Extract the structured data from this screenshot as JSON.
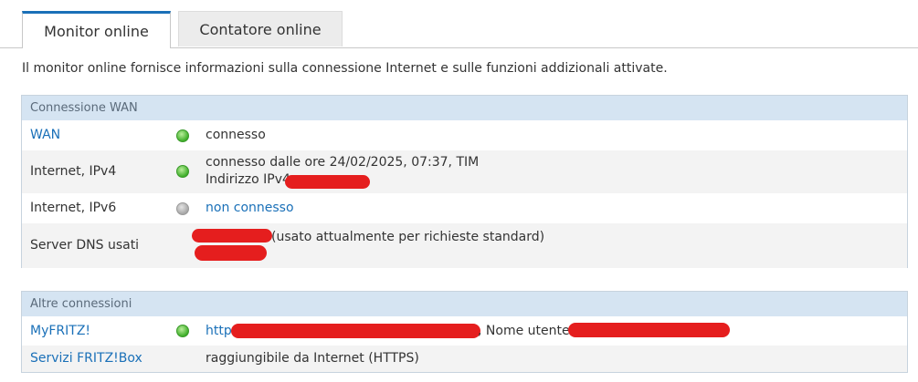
{
  "tabs": {
    "monitor_label": "Monitor online",
    "counter_label": "Contatore online"
  },
  "intro_text": "Il monitor online fornisce informazioni sulla connessione Internet e sulle funzioni addizionali attivate.",
  "wan_panel": {
    "title": "Connessione WAN",
    "rows": [
      {
        "label": "WAN",
        "status": "green",
        "value": "connesso"
      },
      {
        "label": "Internet, IPv4",
        "status": "green",
        "value": "connesso dalle ore 24/02/2025, 07:37, TIM",
        "value2": "Indirizzo IPv4"
      },
      {
        "label": "Internet, IPv6",
        "status": "grey",
        "value": "non connesso"
      },
      {
        "label": "Server DNS usati",
        "value": "(usato attualmente per richieste standard)"
      }
    ]
  },
  "other_panel": {
    "title": "Altre connessioni",
    "rows": [
      {
        "label": "MyFRITZ!",
        "status": "green",
        "value_prefix": "http",
        "value_middle": ", Nome utente:"
      },
      {
        "label": "Servizi FRITZ!Box",
        "value": "raggiungibile da Internet (HTTPS)"
      }
    ]
  },
  "colors": {
    "accent": "#1a70b8",
    "panel_header": "#d5e4f2",
    "status_green": "#3fae2a",
    "status_grey": "#a6a6a6",
    "redaction": "#e51e1e"
  }
}
